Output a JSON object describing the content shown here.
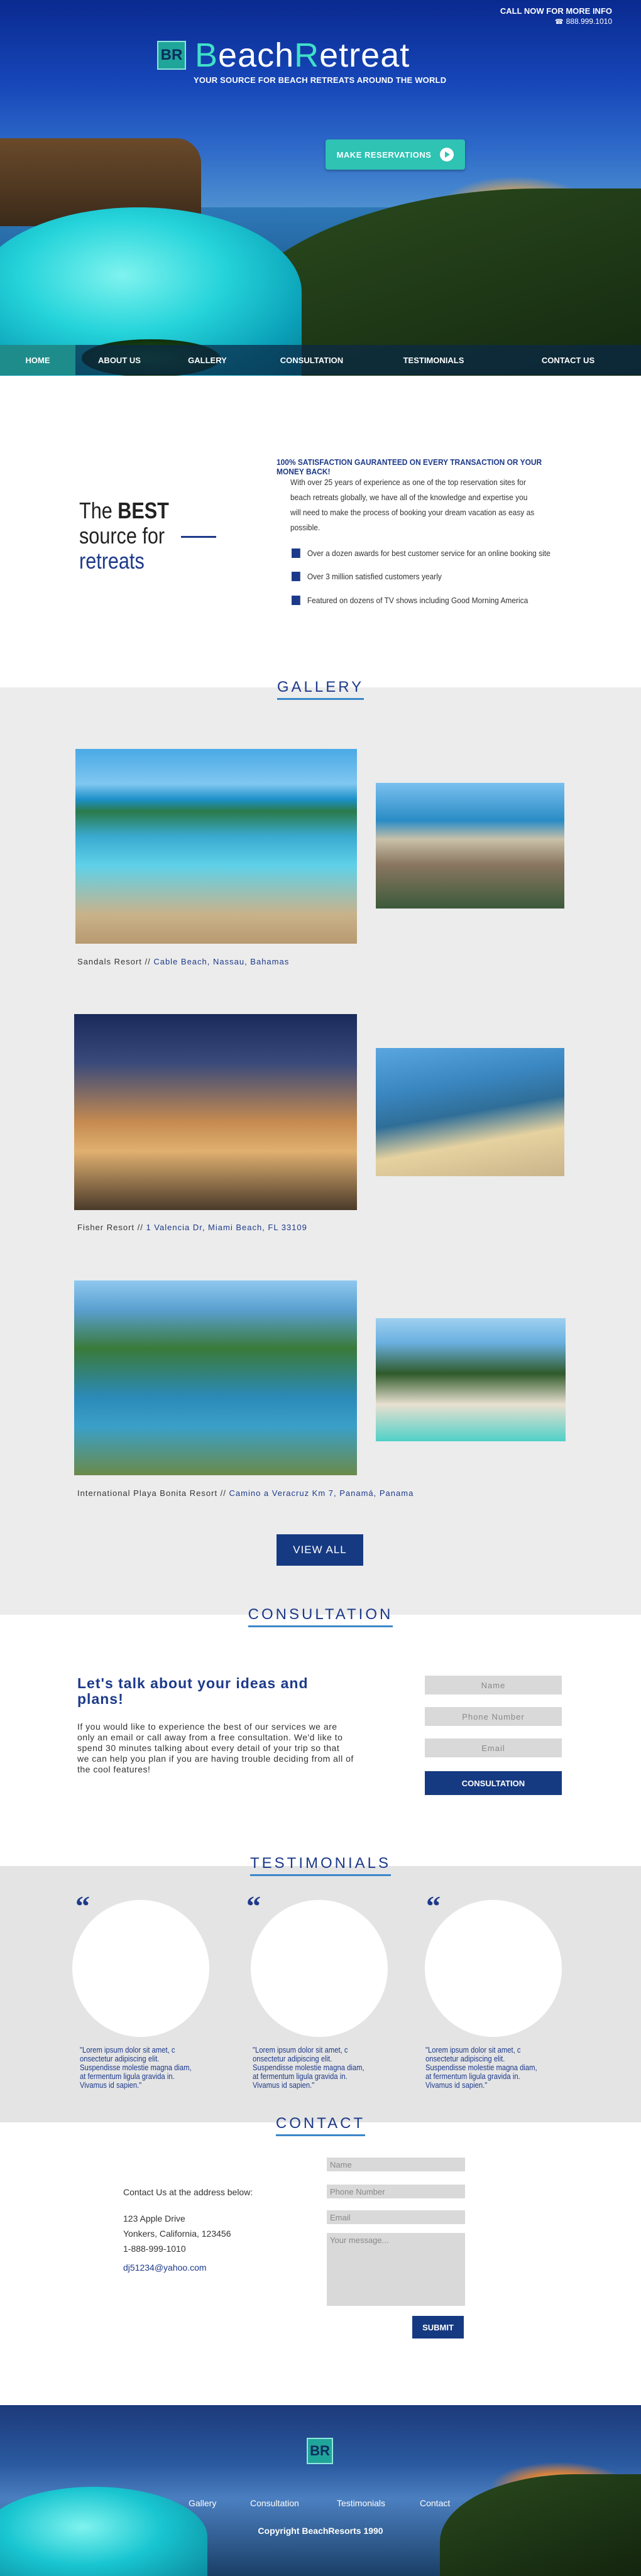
{
  "header": {
    "call_label": "CALL NOW FOR MORE INFO",
    "phone": "888.999.1010",
    "phone_icon": "phone-icon",
    "logo_badge": "BR",
    "logo_b1": "B",
    "logo_text1": "each",
    "logo_r": "R",
    "logo_text2": "etreat",
    "tagline": "YOUR SOURCE FOR BEACH RETREATS AROUND THE WORLD",
    "cta": "MAKE RESERVATIONS"
  },
  "nav": [
    "HOME",
    "ABOUT US",
    "GALLERY",
    "CONSULTATION",
    "TESTIMONIALS",
    "CONTACT US"
  ],
  "about": {
    "h_the": "The ",
    "h_best": "BEST",
    "h_source": "source for",
    "h_retreats": "retreats",
    "guarantee": "100% SATISFACTION GAURANTEED ON EVERY TRANSACTION OR YOUR MONEY BACK!",
    "intro": "With over 25 years of experience as one of the top reservation sites for beach retreats globally, we have all of the knowledge and expertise you will need to make the process of booking your dream vacation as easy as possible.",
    "bullets": [
      "Over a dozen awards for best customer service for an online booking site",
      "Over 3 million satisfied customers yearly",
      "Featured on dozens of TV shows including Good Morning America"
    ]
  },
  "gallery": {
    "title": "GALLERY",
    "items": [
      {
        "name": "Sandals Resort // ",
        "addr": "Cable Beach, Nassau, Bahamas"
      },
      {
        "name": "Fisher Resort // ",
        "addr": "1 Valencia Dr, Miami Beach, FL 33109"
      },
      {
        "name": "International Playa Bonita Resort // ",
        "addr": "Camino a Veracruz Km 7, Panamá, Panama"
      }
    ],
    "view_all": "VIEW ALL"
  },
  "consultation": {
    "title": "CONSULTATION",
    "heading": "Let's talk about your ideas and plans!",
    "body": "If you would like to experience the best of our services we are only an email or call away from a free consultation.  We'd like to spend 30 minutes talking about every detail of your trip so that we can help you plan if you are having trouble deciding from all of the cool features!",
    "ph_name": "Name",
    "ph_phone": "Phone Number",
    "ph_email": "Email",
    "button": "CONSULTATION"
  },
  "testimonials": {
    "title": "TESTIMONIALS",
    "quote": "\"Lorem ipsum dolor sit amet, c onsectetur adipiscing elit. Suspendisse molestie magna diam, at fermentum ligula gravida in. Vivamus id sapien.\""
  },
  "contact": {
    "title": "CONTACT",
    "label": "Contact Us at the address below:",
    "street": "123 Apple Drive",
    "city": "Yonkers, California, 123456",
    "phone": "1-888-999-1010",
    "email": "dj51234@yahoo.com",
    "ph_name": "Name",
    "ph_phone": "Phone Number",
    "ph_email": "Email",
    "ph_msg": "Your message...",
    "submit": "SUBMIT"
  },
  "footer": {
    "badge": "BR",
    "links": [
      "Gallery",
      "Consultation",
      "Testimonials",
      "Contact"
    ],
    "copyright": "Copyright BeachResorts 1990"
  }
}
